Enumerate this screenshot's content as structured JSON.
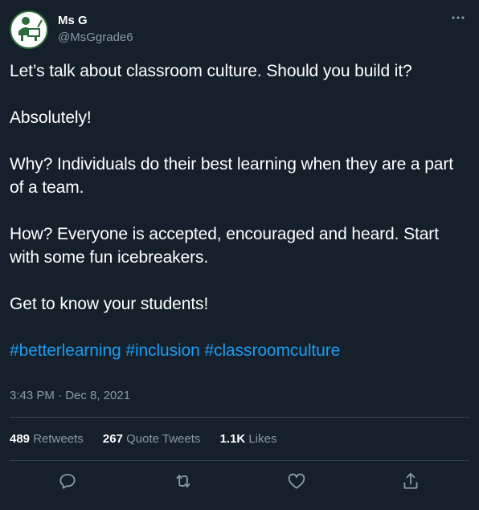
{
  "author": {
    "display_name": "Ms G",
    "handle": "@MsGgrade6",
    "avatar_icon": "classroom-teacher-avatar"
  },
  "tweet": {
    "paragraphs": [
      "Let’s talk about classroom culture. Should you build it?",
      "Absolutely!",
      "Why? Individuals do their best learning when they are a part of a team.",
      "How? Everyone is accepted, encouraged and heard. Start with some fun icebreakers.",
      "Get to know your students!"
    ],
    "hashtags": [
      "#betterlearning",
      "#inclusion",
      "#classroomculture"
    ],
    "timestamp": "3:43 PM · Dec 8, 2021"
  },
  "stats": {
    "retweets_count": "489",
    "retweets_label": "Retweets",
    "quotes_count": "267",
    "quotes_label": "Quote Tweets",
    "likes_count": "1.1K",
    "likes_label": "Likes"
  },
  "actions": [
    {
      "icon": "reply-icon"
    },
    {
      "icon": "retweet-icon"
    },
    {
      "icon": "like-icon"
    },
    {
      "icon": "share-icon"
    }
  ],
  "colors": {
    "background": "#15202b",
    "text": "#ffffff",
    "muted": "#8b98a5",
    "link": "#1d9bf0",
    "divider": "#38444d",
    "avatar_green": "#2e6b3a"
  }
}
